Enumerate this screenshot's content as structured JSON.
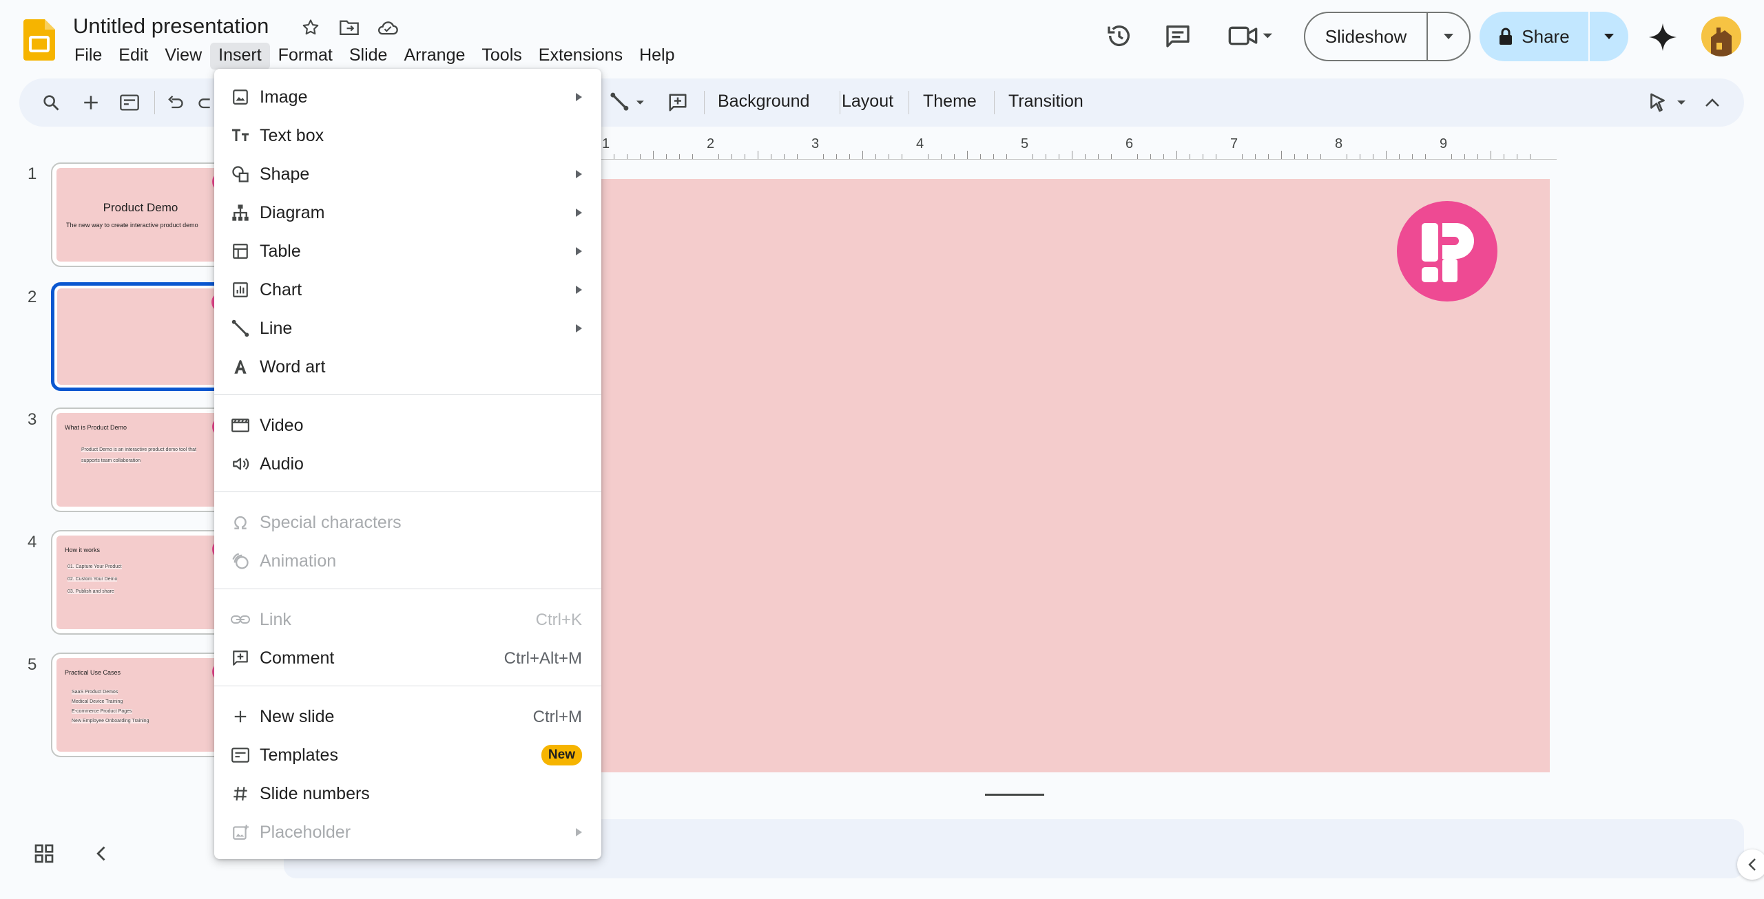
{
  "app": {
    "doc_title": "Untitled presentation",
    "menu": [
      "File",
      "Edit",
      "View",
      "Insert",
      "Format",
      "Slide",
      "Arrange",
      "Tools",
      "Extensions",
      "Help"
    ],
    "active_menu": "Insert"
  },
  "header": {
    "slideshow_label": "Slideshow",
    "share_label": "Share"
  },
  "toolbar": {
    "background_label": "Background",
    "layout_label": "Layout",
    "theme_label": "Theme",
    "transition_label": "Transition"
  },
  "ruler": {
    "marks": [
      "1",
      "2",
      "3",
      "4",
      "5",
      "6",
      "7",
      "8",
      "9"
    ]
  },
  "slides": [
    {
      "number": "1",
      "title": "Product Demo",
      "subtitle": "The new way to create interactive product demo"
    },
    {
      "number": "2",
      "title": "",
      "selected": true
    },
    {
      "number": "3",
      "title": "What is Product Demo",
      "lines": [
        "Product Demo is an interactive product demo tool that",
        "supports team collaboration"
      ]
    },
    {
      "number": "4",
      "title": "How it works",
      "lines": [
        "01. Capture Your Product",
        "02. Custom Your Demo",
        "03. Publish and share"
      ]
    },
    {
      "number": "5",
      "title": "Practical Use Cases",
      "lines": [
        "SaaS Product Demos",
        "Medical Device Training",
        "E-commerce Product Pages",
        "New Employee Onboarding Training"
      ]
    }
  ],
  "insert_menu": {
    "image": "Image",
    "text_box": "Text box",
    "shape": "Shape",
    "diagram": "Diagram",
    "table": "Table",
    "chart": "Chart",
    "line": "Line",
    "word_art": "Word art",
    "video": "Video",
    "audio": "Audio",
    "special_characters": "Special characters",
    "animation": "Animation",
    "link": "Link",
    "link_shortcut": "Ctrl+K",
    "comment": "Comment",
    "comment_shortcut": "Ctrl+Alt+M",
    "new_slide": "New slide",
    "new_slide_shortcut": "Ctrl+M",
    "templates": "Templates",
    "templates_badge": "New",
    "slide_numbers": "Slide numbers",
    "placeholder": "Placeholder"
  },
  "colors": {
    "slide_bg": "#f4cccc",
    "brand_pink": "#ee4a93",
    "accent_blue": "#0b57d0",
    "share_bg": "#c2e7ff",
    "badge_yellow": "#f6b400"
  }
}
